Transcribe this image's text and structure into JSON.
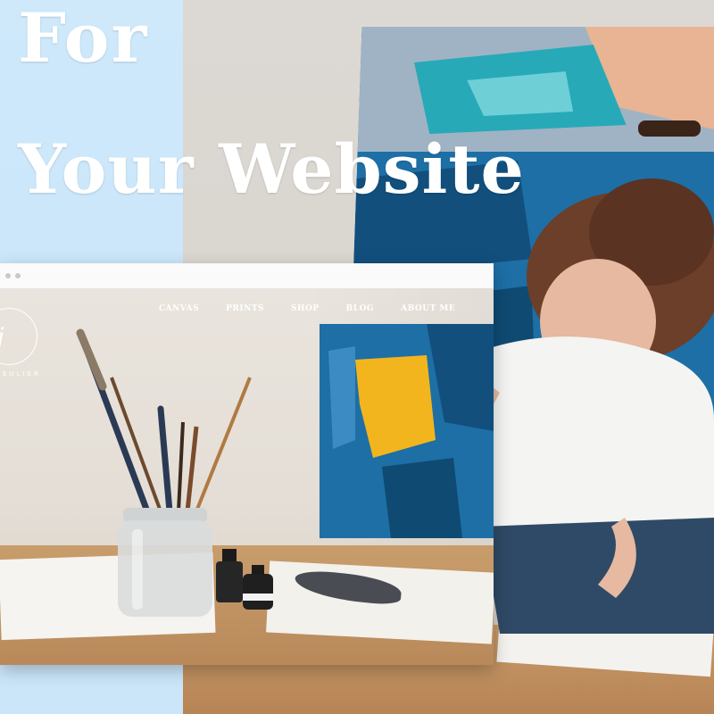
{
  "headline": {
    "line1": "For",
    "line2": "Your Website"
  },
  "website": {
    "logo_letter": "j",
    "brand_text": "JEULIER",
    "nav": [
      "CANVAS",
      "PRINTS",
      "SHOP",
      "BLOG",
      "ABOUT ME"
    ]
  },
  "colors": {
    "left_strip": "#cfe9fb",
    "canvas_blue": "#1d6fa5",
    "canvas_teal": "#27a9b8",
    "canvas_yellow": "#f2b51e",
    "canvas_peach": "#e8b494"
  }
}
